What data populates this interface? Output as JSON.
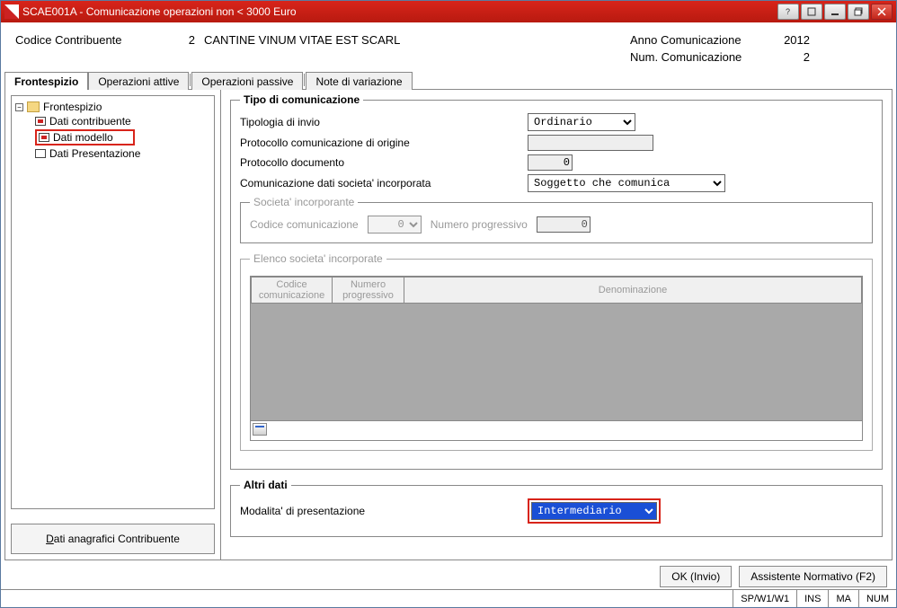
{
  "window": {
    "title": "SCAE001A - Comunicazione operazioni non < 3000 Euro"
  },
  "titlebar_icons": {
    "help": "help-icon",
    "restore1": "restore-icon",
    "min": "minimize-icon",
    "restore2": "restore-icon",
    "close": "close-icon"
  },
  "header": {
    "contrib_label": "Codice Contribuente",
    "contrib_code": "2",
    "contrib_name": "CANTINE VINUM VITAE EST SCARL",
    "anno_label": "Anno Comunicazione",
    "anno_value": "2012",
    "num_label": "Num. Comunicazione",
    "num_value": "2"
  },
  "tabs": {
    "t1": "Frontespizio",
    "t2": "Operazioni attive",
    "t3": "Operazioni passive",
    "t4": "Note di variazione"
  },
  "tree": {
    "root": "Frontespizio",
    "n1": "Dati contribuente",
    "n2": "Dati modello",
    "n3": "Dati Presentazione"
  },
  "sidebar_btn": {
    "pre": "D",
    "rest": "ati anagrafici Contribuente"
  },
  "tipo": {
    "legend": "Tipo di comunicazione",
    "tipologia_label": "Tipologia di invio",
    "tipologia_value": "Ordinario",
    "prot_origine_label": "Protocollo comunicazione di origine",
    "prot_origine_value": "",
    "prot_doc_label": "Protocollo documento",
    "prot_doc_value": "0",
    "comunic_label": "Comunicazione dati societa' incorporata",
    "comunic_value": "Soggetto che comunica"
  },
  "soc_inc": {
    "legend": "Societa' incorporante",
    "codice_label": "Codice comunicazione",
    "codice_value": "0",
    "numprog_label": "Numero progressivo",
    "numprog_value": "0"
  },
  "elenco": {
    "legend": "Elenco societa' incorporate",
    "col1": "Codice comunicazione",
    "col2": "Numero progressivo",
    "col3": "Denominazione"
  },
  "altri": {
    "legend": "Altri dati",
    "modalita_label": "Modalita' di presentazione",
    "modalita_value": "Intermediario"
  },
  "footer": {
    "ok": "OK (Invio)",
    "assist": "Assistente Normativo (F2)"
  },
  "status": {
    "s1": "SP/W1/W1",
    "s2": "INS",
    "s3": "MA",
    "s4": "NUM"
  }
}
